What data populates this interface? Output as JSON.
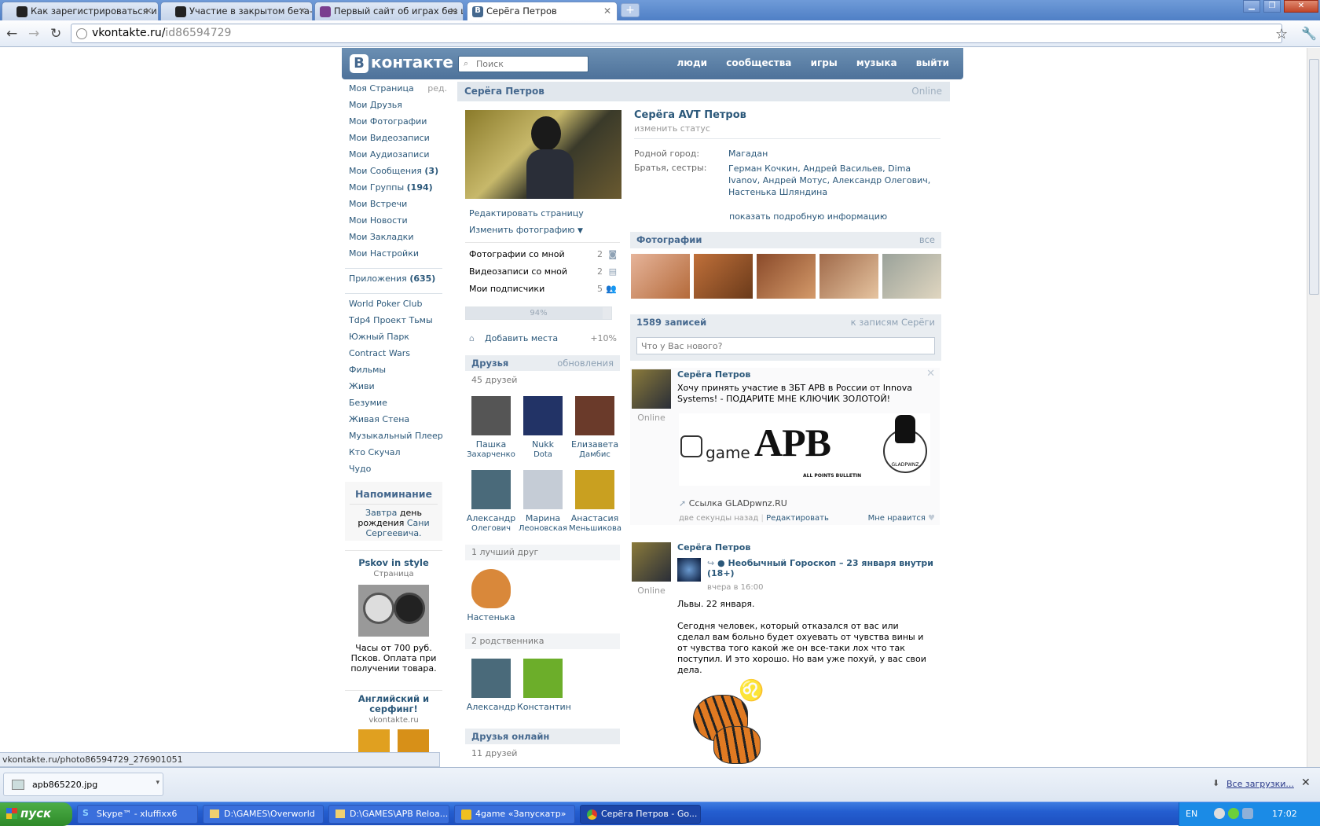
{
  "browser": {
    "tabs": [
      {
        "title": "Как зарегистрироваться и ак",
        "color": "#222"
      },
      {
        "title": "Участие в закрытом бета-те",
        "color": "#222"
      },
      {
        "title": "Первый сайт об играх без це",
        "color": "#7a3e8e"
      },
      {
        "title": "Серёга Петров",
        "color": "#45688e"
      }
    ],
    "url_domain": "vkontakte.ru/",
    "url_path": "id86594729",
    "status_url": "vkontakte.ru/photo86594729_276901051"
  },
  "vk": {
    "logo": "контакте",
    "logo_b": "В",
    "search_placeholder": "Поиск",
    "menu": [
      "люди",
      "сообщества",
      "игры",
      "музыка",
      "выйти"
    ],
    "left_menu": [
      {
        "label": "Моя Страница",
        "extra": "ред."
      },
      {
        "label": "Мои Друзья"
      },
      {
        "label": "Мои Фотографии"
      },
      {
        "label": "Мои Видеозаписи"
      },
      {
        "label": "Мои Аудиозаписи"
      },
      {
        "label": "Мои Сообщения",
        "count": "(3)"
      },
      {
        "label": "Мои Группы",
        "count": "(194)"
      },
      {
        "label": "Мои Встречи"
      },
      {
        "label": "Мои Новости"
      },
      {
        "label": "Мои Закладки"
      },
      {
        "label": "Мои Настройки"
      }
    ],
    "apps_label": "Приложения",
    "apps_count": "(635)",
    "apps": [
      "World Poker Club",
      "Tdp4 Проект Тьмы",
      "Южный Парк",
      "Contract Wars",
      "Фильмы",
      "Живи",
      "Безумие",
      "Живая Стена",
      "Музыкальный Плеер",
      "Кто Скучал",
      "Чудо"
    ],
    "reminder": {
      "title": "Напоминание",
      "t1": "Завтра",
      "t2": "день рождения",
      "t3": "Сани Сергеевича."
    },
    "ad1": {
      "title": "Pskov in style",
      "sub": "Страница",
      "text": "Часы от 700 руб. Псков. Оплата при получении товара."
    },
    "ad2": {
      "title": "Английский и серфинг!",
      "sub": "vkontakte.ru"
    }
  },
  "profile": {
    "header_name": "Серёга Петров",
    "header_online": "Online",
    "full_name": "Серёга AVT Петров",
    "status_hint": "изменить статус",
    "hometown_label": "Родной город:",
    "hometown": "Магадан",
    "siblings_label": "Братья, сестры:",
    "siblings": "Герман Кочкин, Андрей Васильев, Dima Ivanov, Андрей Мотус, Александр Олегович, Настенька Шляндина",
    "more_info": "показать подробную информацию",
    "edit_page": "Редактировать страницу",
    "change_photo": "Изменить фотографию",
    "photos_with_me": "Фотографии со мной",
    "photos_with_me_n": "2",
    "videos_with_me": "Видеозаписи со мной",
    "videos_with_me_n": "2",
    "subscribers": "Мои подписчики",
    "subscribers_n": "5",
    "progress": "94%",
    "progress_value": 0.94,
    "add_place": "Добавить места",
    "add_place_pct": "+10%",
    "friends_title": "Друзья",
    "friends_updates": "обновления",
    "friends_count": "45 друзей",
    "friends": [
      {
        "n1": "Пашка",
        "n2": "Захарченко",
        "c": "#555"
      },
      {
        "n1": "Nukk",
        "n2": "Dota",
        "c": "#223366"
      },
      {
        "n1": "Елизавета",
        "n2": "Дамбис",
        "c": "#6a3a2a"
      },
      {
        "n1": "Александр",
        "n2": "Олегович",
        "c": "#4a6a7a"
      },
      {
        "n1": "Марина",
        "n2": "Леоновская",
        "c": "#c5ccd6"
      },
      {
        "n1": "Анастасия",
        "n2": "Меньшикова",
        "c": "#c9a020"
      }
    ],
    "best_friend_title": "1 лучший друг",
    "best_friend": "Настенька",
    "relatives_title": "2 родственника",
    "relatives": [
      "Александр",
      "Константин"
    ],
    "online_title": "Друзья онлайн",
    "online_count": "11 друзей",
    "photos_title": "Фотографии",
    "photos_all": "все",
    "wall_count": "1589 записей",
    "wall_link": "к записям Серёги",
    "wall_placeholder": "Что у Вас нового?"
  },
  "posts": [
    {
      "author": "Серёга Петров",
      "online": "Online",
      "text": "Хочу принять участие в ЗБТ APB в России от Innova Systems! - ПОДАРИТЕ МНЕ КЛЮЧИК ЗОЛОТОЙ!",
      "banner_game": "game",
      "banner_apb": "APB",
      "banner_sub": "ALL POINTS BULLETIN",
      "banner_seal": "GLADPWNZ",
      "link": "Ссылка GLADpwnz.RU",
      "time": "две секунды назад",
      "edit": "Редактировать",
      "like": "Мне нравится"
    },
    {
      "author": "Серёга Петров",
      "online": "Online",
      "repost": "Необычный Гороскоп  –  23 января внутри (18+)",
      "repost_time": "вчера в 16:00",
      "t1": "Львы. 22 января.",
      "t2": "Сегодня человек, который отказался от вас или сделал вам больно будет охуевать от чувства вины и от чувства того какой же он все-таки лох что так поступил. И это хорошо. Но вам уже похуй, у вас свои дела."
    }
  ],
  "downloads": {
    "file": "apb865220.jpg",
    "all": "Все загрузки..."
  },
  "taskbar": {
    "start": "пуск",
    "items": [
      "Skype™ - xluffixx6",
      "D:\\GAMES\\Overworld",
      "D:\\GAMES\\APB Reloa...",
      "4game «Запускатр»",
      "Серёга Петров - Go..."
    ],
    "lang": "EN",
    "time": "17:02"
  }
}
